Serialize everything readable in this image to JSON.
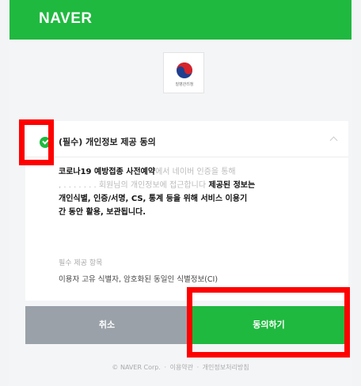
{
  "header": {
    "logo": "NAVER",
    "bg_color": "#1fb93f"
  },
  "org_logo": {
    "icon": "korea-taegeuk-icon",
    "caption": "질병관리청"
  },
  "consent": {
    "title": "(필수) 개인정보 제공 동의",
    "body_bold_1": "코로나19 예방접종 사전예약",
    "body_faded_1": "에서 네이버 인증을 통해",
    "body_faded_2": ", . . . . . . . 회원님의 개인정보에 접근합니다",
    "body_bold_2": " 제공된 정보는",
    "body_line_3": "개인식별, 인증/서명, CS, 통계 등을 위해 서비스 이용기",
    "body_line_4": "간 동안 활용, 보관됩니다.",
    "required_label": "필수 제공 항목",
    "required_items": "이용자 고유 식별자, 암호화된 동일인 식별정보(CI)"
  },
  "buttons": {
    "cancel": "취소",
    "agree": "동의하기"
  },
  "footer": {
    "company": "© NAVER Corp.",
    "terms": "이용약관",
    "privacy": "개인정보처리방침"
  },
  "highlight_color": "#ff0000"
}
